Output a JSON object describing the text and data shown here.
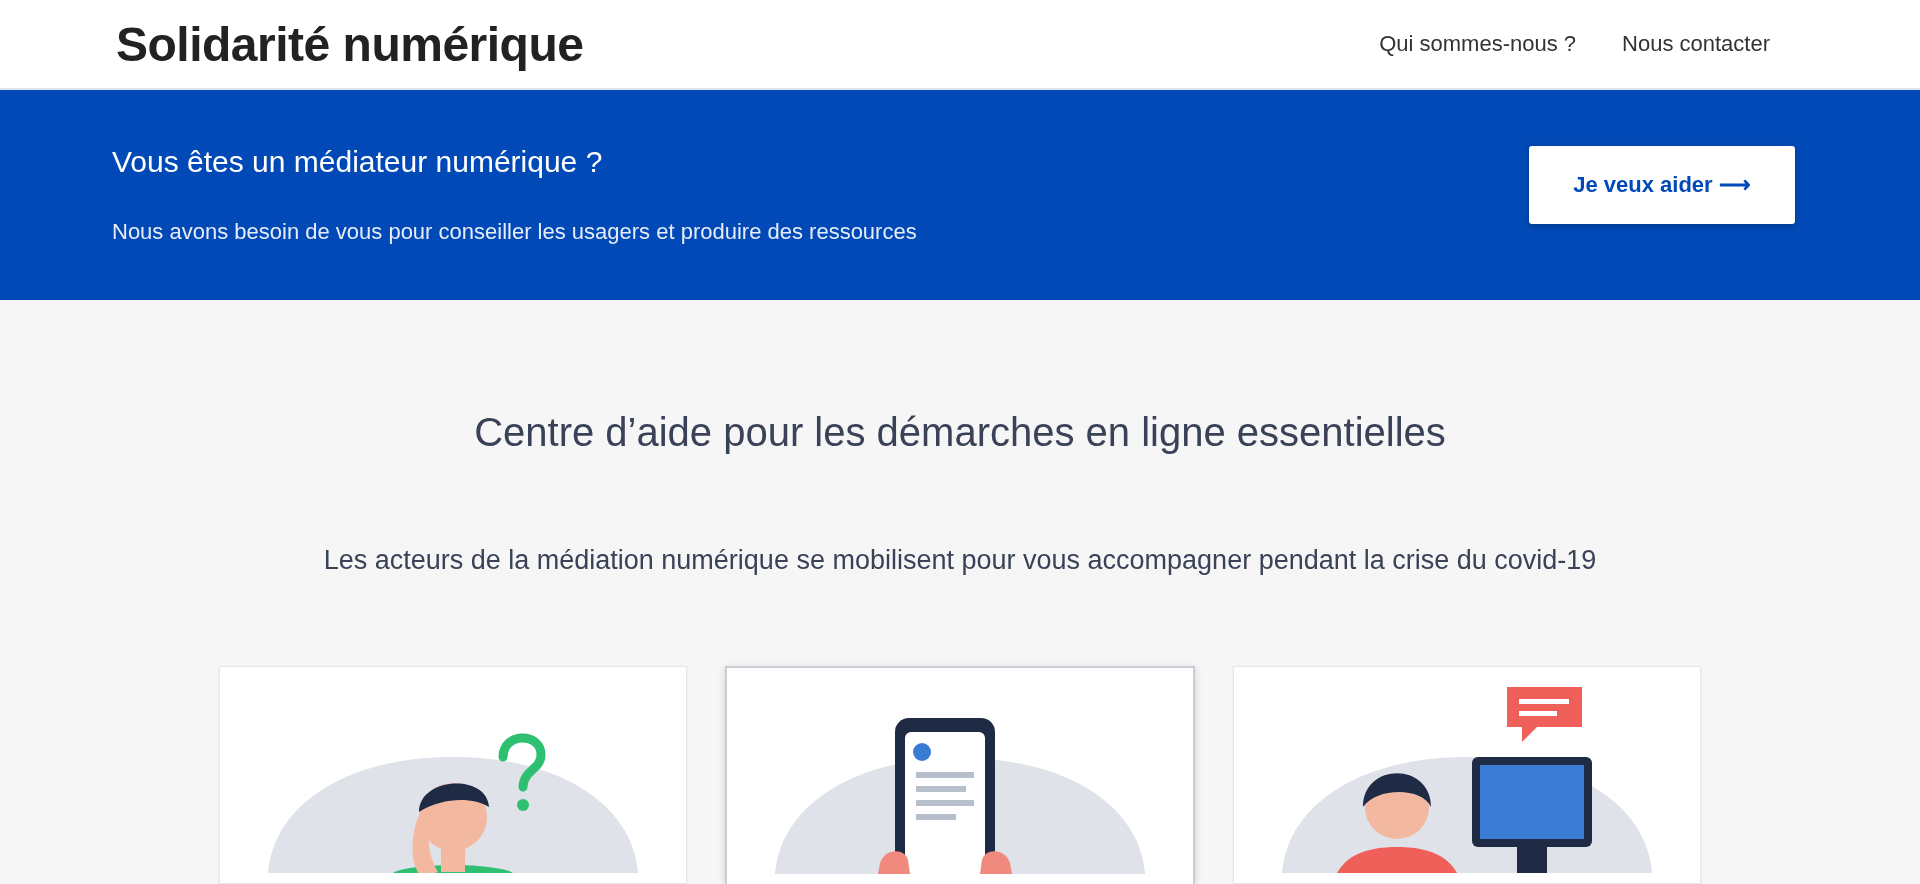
{
  "header": {
    "title": "Solidarité numérique",
    "nav": [
      "Qui sommes-nous ?",
      "Nous contacter"
    ]
  },
  "banner": {
    "heading": "Vous êtes un médiateur numérique ?",
    "text": "Nous avons besoin de vous pour conseiller les usagers et produire des ressources",
    "button": "Je veux aider ⟶"
  },
  "intro": {
    "title": "Centre d’aide pour les démarches en ligne essentielles",
    "subtitle": "Les acteurs de la médiation numérique se mobilisent pour vous accompagner pendant la crise du covid-19"
  },
  "cards": [
    {
      "kind": "question",
      "selected": false
    },
    {
      "kind": "phone",
      "selected": true
    },
    {
      "kind": "support",
      "selected": false
    }
  ]
}
